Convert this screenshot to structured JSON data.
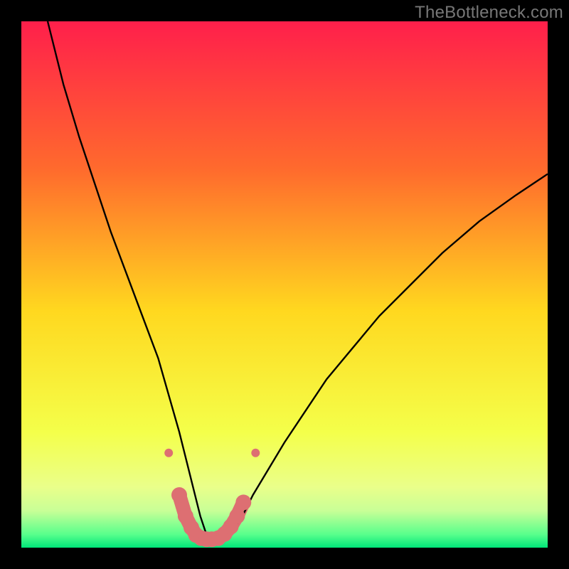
{
  "watermark": "TheBottleneck.com",
  "chart_data": {
    "type": "line",
    "title": "",
    "xlabel": "",
    "ylabel": "",
    "xlim": [
      0,
      100
    ],
    "ylim": [
      0,
      100
    ],
    "grid": false,
    "gradient_stops": [
      {
        "offset": 0,
        "color": "#ff1f4b"
      },
      {
        "offset": 0.28,
        "color": "#ff6a2d"
      },
      {
        "offset": 0.55,
        "color": "#ffd81f"
      },
      {
        "offset": 0.78,
        "color": "#f4ff4a"
      },
      {
        "offset": 0.885,
        "color": "#eaff8a"
      },
      {
        "offset": 0.93,
        "color": "#c8ff97"
      },
      {
        "offset": 0.975,
        "color": "#58ff8c"
      },
      {
        "offset": 1.0,
        "color": "#00e579"
      }
    ],
    "series": [
      {
        "name": "bottleneck-curve",
        "x": [
          5,
          8,
          11,
          14,
          17,
          20,
          23,
          26,
          28,
          30,
          31.5,
          33,
          34,
          35,
          36,
          38,
          40,
          42,
          44,
          47,
          50,
          54,
          58,
          63,
          68,
          74,
          80,
          87,
          94,
          100
        ],
        "y": [
          100,
          88,
          78,
          69,
          60,
          52,
          44,
          36,
          29,
          22,
          16,
          10,
          6,
          3,
          1.5,
          1.5,
          3,
          6,
          10,
          15,
          20,
          26,
          32,
          38,
          44,
          50,
          56,
          62,
          67,
          71
        ],
        "stroke": "#000000",
        "stroke_width": 2.4
      }
    ],
    "marker_series": {
      "name": "bottom-markers",
      "points": [
        {
          "x": 28,
          "y": 18
        },
        {
          "x": 30,
          "y": 10
        },
        {
          "x": 31.2,
          "y": 6
        },
        {
          "x": 32.3,
          "y": 3.8
        },
        {
          "x": 33.2,
          "y": 2.4
        },
        {
          "x": 34.2,
          "y": 1.8
        },
        {
          "x": 35.2,
          "y": 1.6
        },
        {
          "x": 36.2,
          "y": 1.6
        },
        {
          "x": 37.4,
          "y": 1.8
        },
        {
          "x": 38.6,
          "y": 2.6
        },
        {
          "x": 39.8,
          "y": 4.0
        },
        {
          "x": 41.0,
          "y": 6.0
        },
        {
          "x": 42.2,
          "y": 8.6
        },
        {
          "x": 44.5,
          "y": 18
        }
      ],
      "dot_color": "#dd6f72",
      "dot_radius_small_px": 6,
      "dot_radius_large_px": 11,
      "connector": {
        "stroke": "#dd6f72",
        "stroke_width_px": 20
      }
    },
    "background_block_color": "#000000"
  }
}
